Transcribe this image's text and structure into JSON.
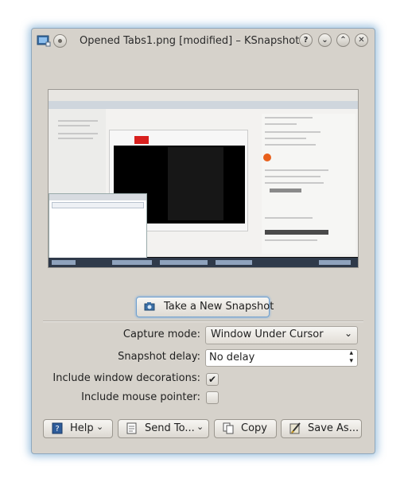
{
  "window": {
    "title": "Opened Tabs1.png [modified] – KSnapshot",
    "controls": {
      "help": "?",
      "minimize": "⌄",
      "maximize": "⌃",
      "close": "✕"
    }
  },
  "preview": {
    "label": "snapshot-preview"
  },
  "new_snapshot_button": "Take a New Snapshot",
  "options": {
    "capture_mode_label": "Capture mode:",
    "capture_mode_value": "Window Under Cursor",
    "delay_label": "Snapshot delay:",
    "delay_value": "No delay",
    "decorations_label": "Include window decorations:",
    "decorations_checked": true,
    "pointer_label": "Include mouse pointer:",
    "pointer_checked": false
  },
  "buttons": {
    "help": "Help",
    "send_to": "Send To...",
    "copy": "Copy",
    "save_as": "Save As..."
  },
  "glyphs": {
    "dropdown": "⌄",
    "check": "✔",
    "spin_up": "▴",
    "spin_down": "▾"
  },
  "colors": {
    "window_bg": "#d6d2cb",
    "focus_glow": "#6fa0cf",
    "accent": "#3a6ea5"
  }
}
